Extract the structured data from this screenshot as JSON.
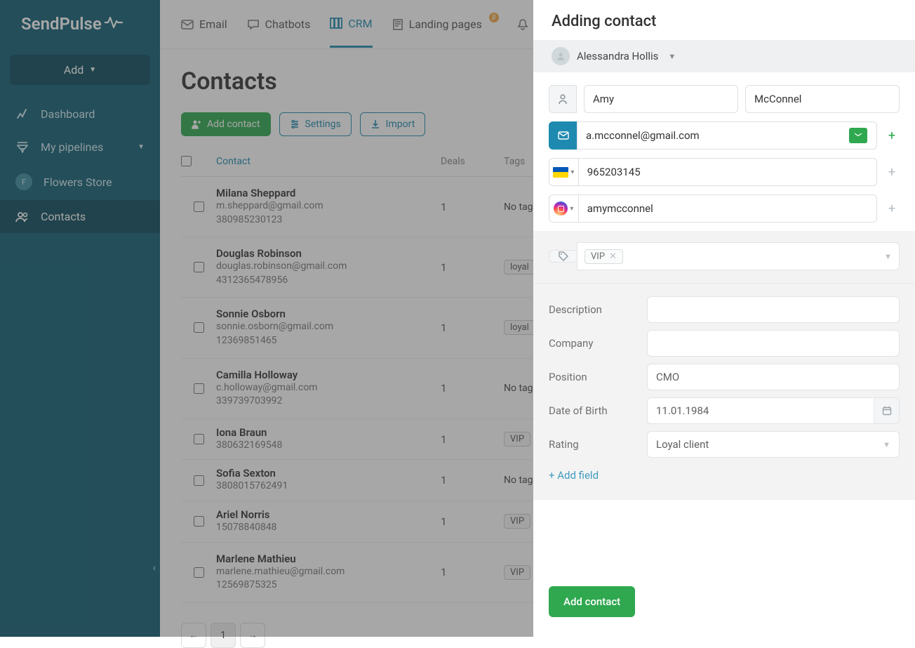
{
  "brand": "SendPulse",
  "sidebar": {
    "add_label": "Add",
    "items": [
      {
        "label": "Dashboard"
      },
      {
        "label": "My pipelines",
        "expandable": true
      },
      {
        "label": "Flowers Store",
        "avatar": "F"
      },
      {
        "label": "Contacts",
        "active": true
      }
    ]
  },
  "topnav": [
    {
      "label": "Email"
    },
    {
      "label": "Chatbots"
    },
    {
      "label": "CRM",
      "active": true
    },
    {
      "label": "Landing pages",
      "badge": "β"
    },
    {
      "label": "Push"
    }
  ],
  "page": {
    "title": "Contacts",
    "add_contact": "Add contact",
    "settings": "Settings",
    "import": "Import"
  },
  "table": {
    "headers": {
      "contact": "Contact",
      "deals": "Deals",
      "tags": "Tags"
    },
    "rows": [
      {
        "name": "Milana Sheppard",
        "email": "m.sheppard@gmail.com",
        "phone": "380985230123",
        "deals": "1",
        "tags_label": "No tags"
      },
      {
        "name": "Douglas Robinson",
        "email": "douglas.robinson@gmail.com",
        "phone": "4312365478956",
        "deals": "1",
        "tag_chip": "loyal"
      },
      {
        "name": "Sonnie Osborn",
        "email": "sonnie.osborn@gmail.com",
        "phone": "12369851465",
        "deals": "1",
        "tag_chip": "loyal"
      },
      {
        "name": "Camilla Holloway",
        "email": "c.holloway@gmail.com",
        "phone": "339739703992",
        "deals": "1",
        "tags_label": "No tags"
      },
      {
        "name": "Iona Braun",
        "email": "",
        "phone": "380632169548",
        "deals": "1",
        "tag_chip": "VIP"
      },
      {
        "name": "Sofia Sexton",
        "email": "",
        "phone": "3808015762491",
        "deals": "1",
        "tags_label": "No tags"
      },
      {
        "name": "Ariel Norris",
        "email": "",
        "phone": "15078840848",
        "deals": "1",
        "tag_chip": "VIP"
      },
      {
        "name": "Marlene Mathieu",
        "email": "marlene.mathieu@gmail.com",
        "phone": "12569875325",
        "deals": "1",
        "tag_chip": "VIP"
      }
    ],
    "pagination": {
      "prev": "←",
      "current": "1",
      "next": "→"
    }
  },
  "drawer": {
    "title": "Adding contact",
    "owner": "Alessandra Hollis",
    "first_name": "Amy",
    "last_name": "McConnel",
    "email": "a.mcconnel@gmail.com",
    "phone": "965203145",
    "social": "amymcconnel",
    "tag": "VIP",
    "fields": {
      "description_label": "Description",
      "description_value": "",
      "company_label": "Company",
      "company_value": "",
      "position_label": "Position",
      "position_value": "CMO",
      "dob_label": "Date of Birth",
      "dob_value": "11.01.1984",
      "rating_label": "Rating",
      "rating_value": "Loyal client"
    },
    "add_field": "+ Add field",
    "submit": "Add contact"
  }
}
